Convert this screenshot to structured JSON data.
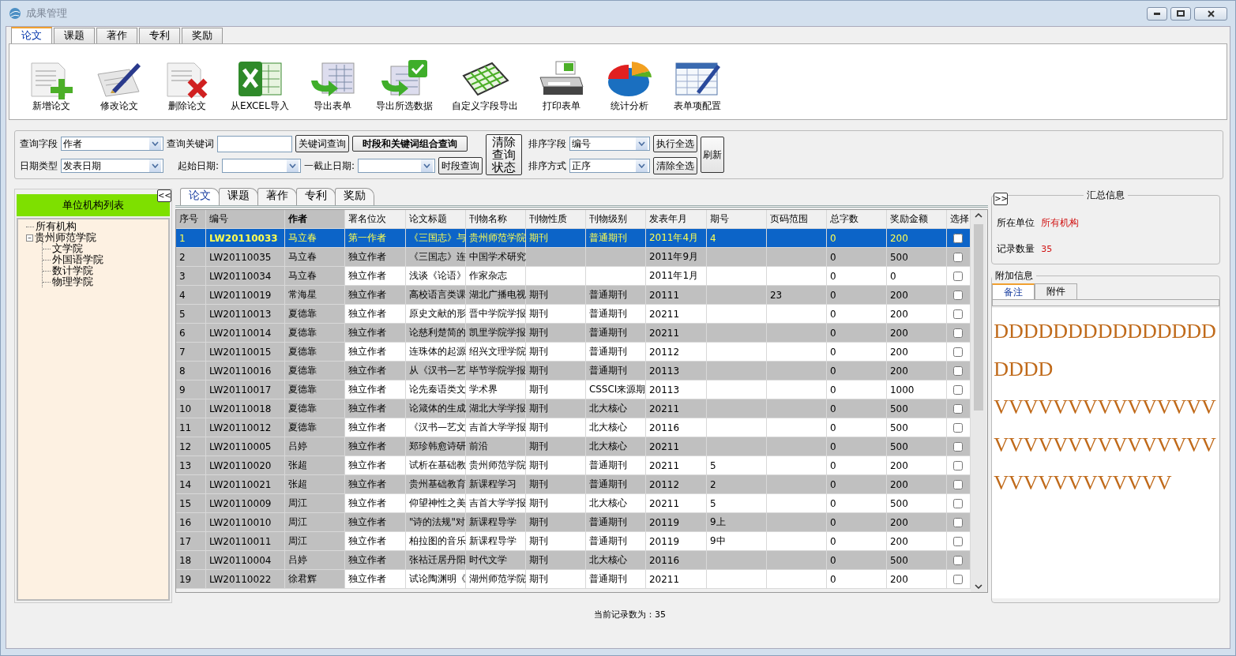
{
  "window": {
    "title": "成果管理"
  },
  "tabs": [
    {
      "label": "论文",
      "selected": true
    },
    {
      "label": "课题",
      "selected": false
    },
    {
      "label": "著作",
      "selected": false
    },
    {
      "label": "专利",
      "selected": false
    },
    {
      "label": "奖励",
      "selected": false
    }
  ],
  "toolbar": [
    "新增论文",
    "修改论文",
    "删除论文",
    "从EXCEL导入",
    "导出表单",
    "导出所选数据",
    "自定义字段导出",
    "打印表单",
    "统计分析",
    "表单项配置"
  ],
  "query": {
    "field_label": "查询字段",
    "field_value": "作者",
    "keyword_label": "查询关键词",
    "keyword_button": "关键词查询",
    "combined_button": "时段和关键词组合查询",
    "date_type_label": "日期类型",
    "date_type_value": "发表日期",
    "start_label": "起始日期:",
    "end_label": "一截止日期:",
    "period_button": "时段查询",
    "clear_button": "清除查询状态",
    "sort_field_label": "排序字段",
    "sort_field_value": "编号",
    "sort_order_label": "排序方式",
    "sort_order_value": "正序",
    "select_all_button": "执行全选",
    "clear_all_button": "清除全选",
    "refresh_button": "刷新"
  },
  "org_panel": {
    "title": "单位机构列表",
    "collapse_button": "<<",
    "tree": [
      {
        "label": "所有机构"
      },
      {
        "label": "贵州师范学院",
        "expanded": true,
        "children": [
          {
            "label": "文学院"
          },
          {
            "label": "外国语学院"
          },
          {
            "label": "数计学院"
          },
          {
            "label": "物理学院"
          }
        ]
      }
    ]
  },
  "grid": {
    "tabs": [
      {
        "label": "论文",
        "selected": true
      },
      {
        "label": "课题",
        "selected": false
      },
      {
        "label": "著作",
        "selected": false
      },
      {
        "label": "专利",
        "selected": false
      },
      {
        "label": "奖励",
        "selected": false
      }
    ],
    "columns": [
      "序号",
      "编号",
      "作者",
      "署名位次",
      "论文标题",
      "刊物名称",
      "刊物性质",
      "刊物级别",
      "发表年月",
      "期号",
      "页码范围",
      "总字数",
      "奖励金额",
      "选择"
    ],
    "rows": [
      {
        "cells": [
          "1",
          "LW20110033",
          "马立春",
          "第一作者",
          "《三国志》与",
          "贵州师范学院",
          "期刊",
          "普通期刊",
          "2011年4月",
          "4",
          null,
          "0",
          "200"
        ],
        "checked": false,
        "selected": true
      },
      {
        "cells": [
          "2",
          "LW20110035",
          "马立春",
          "独立作者",
          "《三国志》连",
          "中国学术研究",
          null,
          null,
          "2011年9月",
          null,
          null,
          "0",
          "500"
        ],
        "checked": false,
        "selected": false
      },
      {
        "cells": [
          "3",
          "LW20110034",
          "马立春",
          "独立作者",
          "浅谈《论语》",
          "作家杂志",
          null,
          null,
          "2011年1月",
          null,
          null,
          "0",
          "0"
        ],
        "checked": false,
        "selected": false
      },
      {
        "cells": [
          "4",
          "LW20110019",
          "常海星",
          "独立作者",
          "高校语言类课",
          "湖北广播电视",
          "期刊",
          "普通期刊",
          "20111",
          null,
          "23",
          "0",
          "200"
        ],
        "checked": false,
        "selected": false
      },
      {
        "cells": [
          "5",
          "LW20110013",
          "夏德靠",
          "独立作者",
          "原史文献的形",
          "晋中学院学报",
          "期刊",
          "普通期刊",
          "20211",
          null,
          null,
          "0",
          "200"
        ],
        "checked": false,
        "selected": false
      },
      {
        "cells": [
          "6",
          "LW20110014",
          "夏德靠",
          "独立作者",
          "论慈利楚简的",
          "凯里学院学报",
          "期刊",
          "普通期刊",
          "20211",
          null,
          null,
          "0",
          "200"
        ],
        "checked": false,
        "selected": false
      },
      {
        "cells": [
          "7",
          "LW20110015",
          "夏德靠",
          "独立作者",
          "连珠体的起源",
          "绍兴文理学院",
          "期刊",
          "普通期刊",
          "20112",
          null,
          null,
          "0",
          "200"
        ],
        "checked": false,
        "selected": false
      },
      {
        "cells": [
          "8",
          "LW20110016",
          "夏德靠",
          "独立作者",
          "从《汉书—艺",
          "毕节学院学报",
          "期刊",
          "普通期刊",
          "20113",
          null,
          null,
          "0",
          "200"
        ],
        "checked": false,
        "selected": false
      },
      {
        "cells": [
          "9",
          "LW20110017",
          "夏德靠",
          "独立作者",
          "论先秦语类文",
          "学术界",
          "期刊",
          "CSSCI来源期",
          "20113",
          null,
          null,
          "0",
          "1000"
        ],
        "checked": false,
        "selected": false
      },
      {
        "cells": [
          "10",
          "LW20110018",
          "夏德靠",
          "独立作者",
          "论箴体的生成",
          "湖北大学学报",
          "期刊",
          "北大核心",
          "20211",
          null,
          null,
          "0",
          "500"
        ],
        "checked": false,
        "selected": false
      },
      {
        "cells": [
          "11",
          "LW20110012",
          "夏德靠",
          "独立作者",
          "《汉书—艺文",
          "吉首大学学报",
          "期刊",
          "北大核心",
          "20116",
          null,
          null,
          "0",
          "500"
        ],
        "checked": false,
        "selected": false
      },
      {
        "cells": [
          "12",
          "LW20110005",
          "吕婷",
          "独立作者",
          "郑珍韩愈诗研",
          "前沿",
          "期刊",
          "北大核心",
          "20211",
          null,
          null,
          "0",
          "500"
        ],
        "checked": false,
        "selected": false
      },
      {
        "cells": [
          "13",
          "LW20110020",
          "张超",
          "独立作者",
          "试析在基础教",
          "贵州师范学院",
          "期刊",
          "普通期刊",
          "20211",
          "5",
          null,
          "0",
          "200"
        ],
        "checked": false,
        "selected": false
      },
      {
        "cells": [
          "14",
          "LW20110021",
          "张超",
          "独立作者",
          "贵州基础教育",
          "新课程学习",
          "期刊",
          "普通期刊",
          "20112",
          "2",
          null,
          "0",
          "200"
        ],
        "checked": false,
        "selected": false
      },
      {
        "cells": [
          "15",
          "LW20110009",
          "周江",
          "独立作者",
          "仰望神性之美",
          "吉首大学学报",
          "期刊",
          "北大核心",
          "20211",
          "5",
          null,
          "0",
          "500"
        ],
        "checked": false,
        "selected": false
      },
      {
        "cells": [
          "16",
          "LW20110010",
          "周江",
          "独立作者",
          "\"诗的法规\"对",
          "新课程导学",
          "期刊",
          "普通期刊",
          "20119",
          "9上",
          null,
          "0",
          "200"
        ],
        "checked": false,
        "selected": false
      },
      {
        "cells": [
          "17",
          "LW20110011",
          "周江",
          "独立作者",
          "柏拉图的音乐",
          "新课程导学",
          "期刊",
          "普通期刊",
          "20119",
          "9中",
          null,
          "0",
          "200"
        ],
        "checked": false,
        "selected": false
      },
      {
        "cells": [
          "18",
          "LW20110004",
          "吕婷",
          "独立作者",
          "张祜迁居丹阳",
          "时代文学",
          "期刊",
          "北大核心",
          "20116",
          null,
          null,
          "0",
          "500"
        ],
        "checked": false,
        "selected": false
      },
      {
        "cells": [
          "19",
          "LW20110022",
          "徐君辉",
          "独立作者",
          "试论陶渊明《",
          "湖州师范学院",
          "期刊",
          "普通期刊",
          "20211",
          null,
          null,
          "0",
          "200"
        ],
        "checked": false,
        "selected": false
      }
    ]
  },
  "status": "当前记录数为：35",
  "summary": {
    "expand_button": ">>",
    "title": "汇总信息",
    "unit_label": "所在单位",
    "unit_value": "所有机构",
    "count_label": "记录数量",
    "count_value": "35"
  },
  "extra": {
    "title": "附加信息",
    "tabs": [
      {
        "label": "备注",
        "selected": true
      },
      {
        "label": "附件",
        "selected": false
      }
    ],
    "note": [
      "DDDDDDDDDDDDDDDDDDD",
      "VVVVVVVVVVVVVVVVVVVVVVVVVVVVVVVVVVVVVVVVVV"
    ]
  }
}
